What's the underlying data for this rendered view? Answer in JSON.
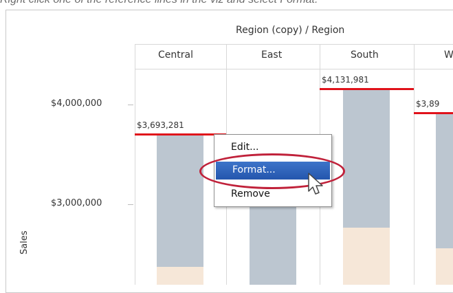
{
  "caption": "Right click one of the reference lines in the viz and select Format.",
  "header": {
    "title": "Region (copy) / Region",
    "columns": [
      "Central",
      "East",
      "South",
      "W"
    ]
  },
  "axis": {
    "label": "Sales",
    "ticks": [
      "$4,000,000",
      "$3,000,000"
    ]
  },
  "reference_labels": [
    "$3,693,281",
    "$4,131,981",
    "$3,89"
  ],
  "context_menu": {
    "items": [
      "Edit...",
      "Format...",
      "Remove"
    ],
    "highlighted": "Format..."
  },
  "colors": {
    "bar_gray": "#bcc6d0",
    "bar_peach": "#f6e7d8",
    "reference_line": "#e0111a",
    "highlight": "#2f63bd",
    "ellipse": "#c0213a"
  }
}
